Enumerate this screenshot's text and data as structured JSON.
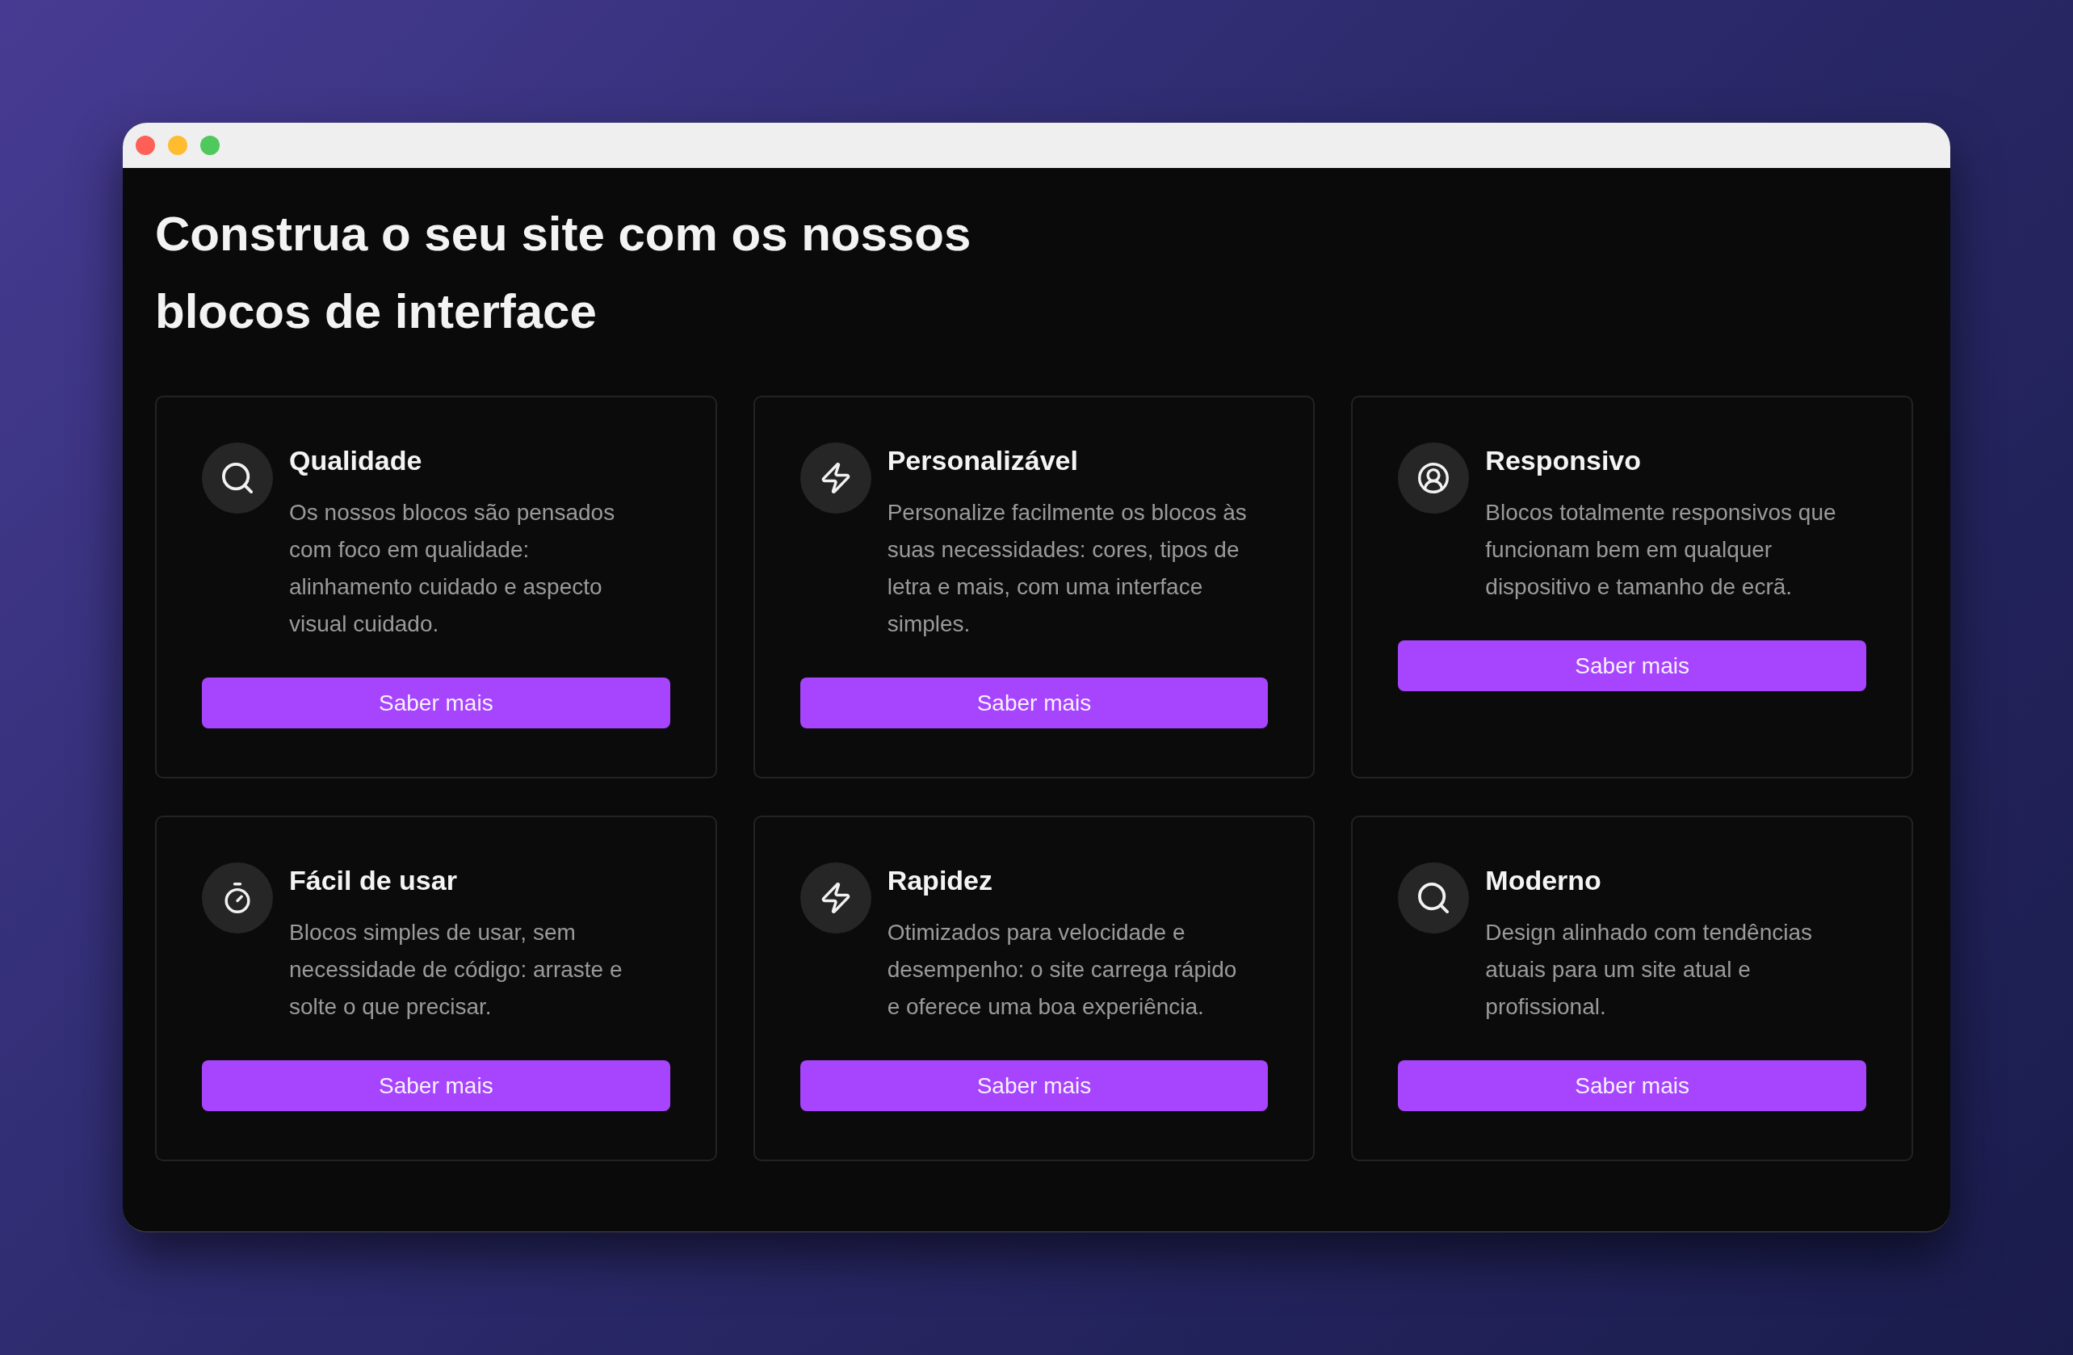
{
  "heading": "Construa o seu site com os nossos blocos de interface",
  "cards": [
    {
      "kind": "search",
      "title": "Qualidade",
      "description": "Os nossos blocos são pensados com foco em qualidade: alinhamento cuidado e aspecto visual cuidado.",
      "button": "Saber mais"
    },
    {
      "kind": "bolt",
      "title": "Personalizável",
      "description": "Personalize facilmente os blocos às suas necessidades: cores, tipos de letra e mais, com uma interface simples.",
      "button": "Saber mais"
    },
    {
      "kind": "user",
      "title": "Responsivo",
      "description": "Blocos totalmente responsivos que funcionam bem em qualquer dispositivo e tamanho de ecrã.",
      "button": "Saber mais"
    },
    {
      "kind": "timer",
      "title": "Fácil de usar",
      "description": "Blocos simples de usar, sem necessidade de código: arraste e solte o que precisar.",
      "button": "Saber mais"
    },
    {
      "kind": "bolt",
      "title": "Rapidez",
      "description": "Otimizados para velocidade e desempenho: o site carrega rápido e oferece uma boa experiência.",
      "button": "Saber mais"
    },
    {
      "kind": "search",
      "title": "Moderno",
      "description": "Design alinhado com tendências atuais para um site atual e profissional.",
      "button": "Saber mais"
    }
  ]
}
